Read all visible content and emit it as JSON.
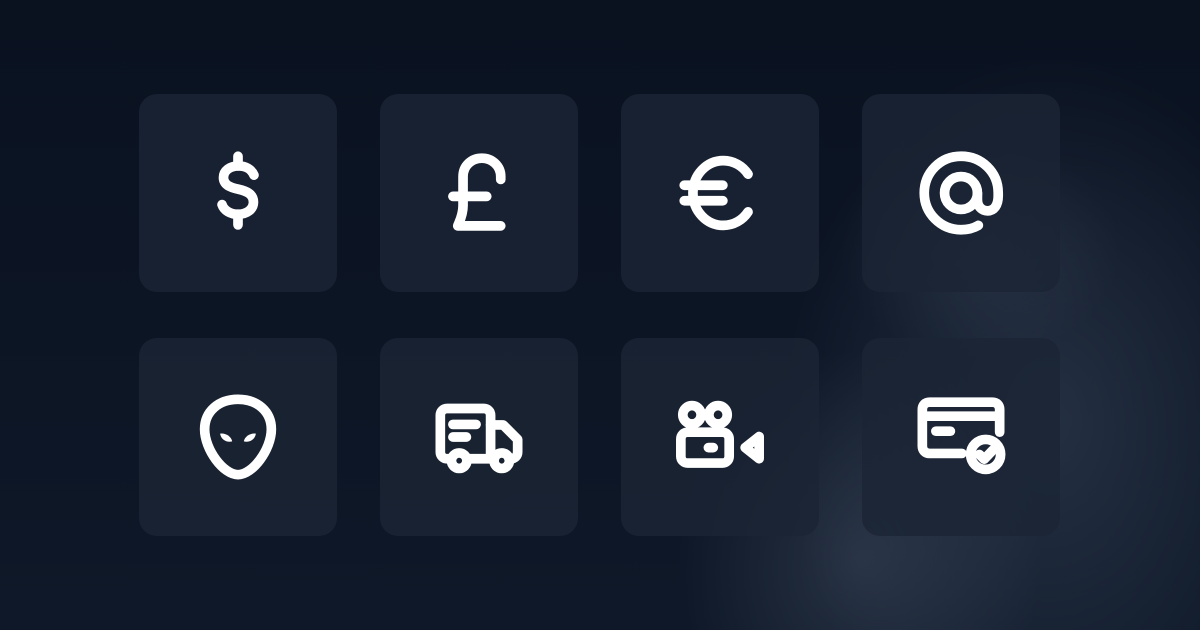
{
  "page": {
    "background_color": "#0b1422",
    "tile_color": "#1b2434",
    "icon_color": "#ffffff"
  },
  "icons": [
    {
      "name": "currency-dollar-icon"
    },
    {
      "name": "currency-pound-icon"
    },
    {
      "name": "currency-euro-icon"
    },
    {
      "name": "at-sign-icon"
    },
    {
      "name": "alien-icon"
    },
    {
      "name": "truck-delivery-icon"
    },
    {
      "name": "video-camera-icon"
    },
    {
      "name": "payment-card-check-icon"
    }
  ]
}
